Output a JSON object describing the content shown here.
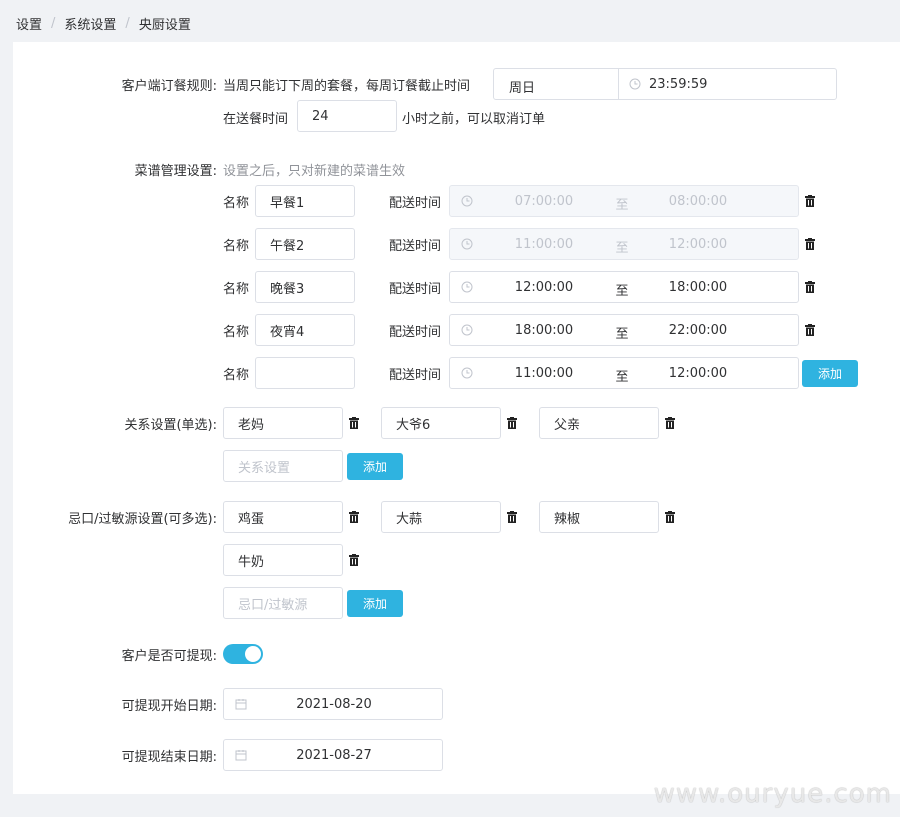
{
  "breadcrumb": [
    "设置",
    "系统设置",
    "央厨设置"
  ],
  "order_rule": {
    "label": "客户端订餐规则:",
    "text1": "当周只能订下周的套餐，每周订餐截止时间",
    "deadline_day": "周日",
    "deadline_time": "23:59:59",
    "text2": "在送餐时间",
    "hours": "24",
    "text3": "小时之前，可以取消订单"
  },
  "menu_settings": {
    "label": "菜谱管理设置:",
    "hint": "设置之后，只对新建的菜谱生效",
    "name_label": "名称",
    "time_label": "配送时间",
    "range_sep": "至",
    "add_label": "添加",
    "meals": [
      {
        "name": "早餐1",
        "start": "07:00:00",
        "end": "08:00:00",
        "disabled": true
      },
      {
        "name": "午餐2",
        "start": "11:00:00",
        "end": "12:00:00",
        "disabled": true
      },
      {
        "name": "晚餐3",
        "start": "12:00:00",
        "end": "18:00:00",
        "disabled": false
      },
      {
        "name": "夜宵4",
        "start": "18:00:00",
        "end": "22:00:00",
        "disabled": false
      }
    ],
    "new_meal": {
      "name": "",
      "start": "11:00:00",
      "end": "12:00:00"
    }
  },
  "relations": {
    "label": "关系设置(单选):",
    "items": [
      "老妈",
      "大爷6",
      "父亲"
    ],
    "placeholder": "关系设置",
    "add_label": "添加"
  },
  "allergens": {
    "label": "忌口/过敏源设置(可多选):",
    "items": [
      "鸡蛋",
      "大蒜",
      "辣椒",
      "牛奶"
    ],
    "placeholder": "忌口/过敏源",
    "add_label": "添加"
  },
  "withdraw": {
    "label": "客户是否可提现:",
    "enabled": true,
    "start_label": "可提现开始日期:",
    "start_date": "2021-08-20",
    "end_label": "可提现结束日期:",
    "end_date": "2021-08-27"
  },
  "watermark": "www.ouryue.com",
  "colors": {
    "accent": "#2fb3e0",
    "border": "#dcdfe6",
    "background": "#f0f2f5"
  }
}
